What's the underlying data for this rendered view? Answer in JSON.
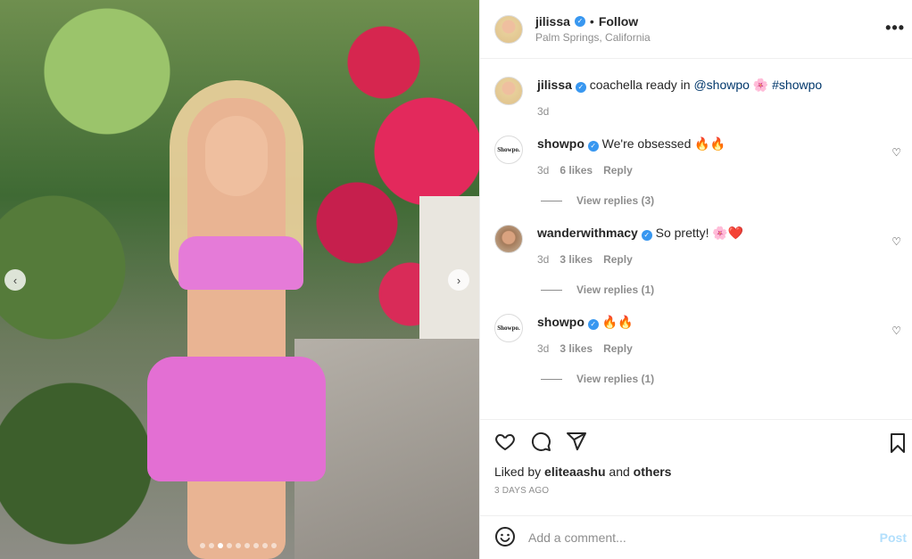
{
  "post": {
    "username": "jilissa",
    "follow_label": "Follow",
    "separator": "•",
    "location": "Palm Springs, California",
    "more_label": "•••"
  },
  "caption": {
    "username": "jilissa",
    "text_prefix": "coachella ready in",
    "mention": "@showpo",
    "emoji": "🌸",
    "hashtag": "#showpo",
    "time": "3d"
  },
  "comments": [
    {
      "username": "showpo",
      "text": "We're obsessed 🔥🔥",
      "time": "3d",
      "likes": "6 likes",
      "reply": "Reply",
      "view_replies": "View replies (3)"
    },
    {
      "username": "wanderwithmacy",
      "text": "So pretty! 🌸❤️",
      "time": "3d",
      "likes": "3 likes",
      "reply": "Reply",
      "view_replies": "View replies (1)"
    },
    {
      "username": "showpo",
      "text": "🔥🔥",
      "time": "3d",
      "likes": "3 likes",
      "reply": "Reply",
      "view_replies": "View replies (1)"
    }
  ],
  "avatars": {
    "showpo_text": "Showpo."
  },
  "carousel": {
    "total": 9,
    "active_index": 2,
    "left_arrow": "‹",
    "right_arrow": "›"
  },
  "actions": {
    "liked_by_prefix": "Liked by",
    "liked_by_user": "eliteaashu",
    "liked_by_and": "and",
    "liked_by_others": "others",
    "timestamp": "3 DAYS AGO"
  },
  "add_comment": {
    "placeholder": "Add a comment...",
    "post_label": "Post",
    "emoji_icon": "smiley-icon"
  },
  "colors": {
    "link": "#00376b",
    "verified": "#3897f0",
    "post_disabled": "#b2dffc"
  }
}
